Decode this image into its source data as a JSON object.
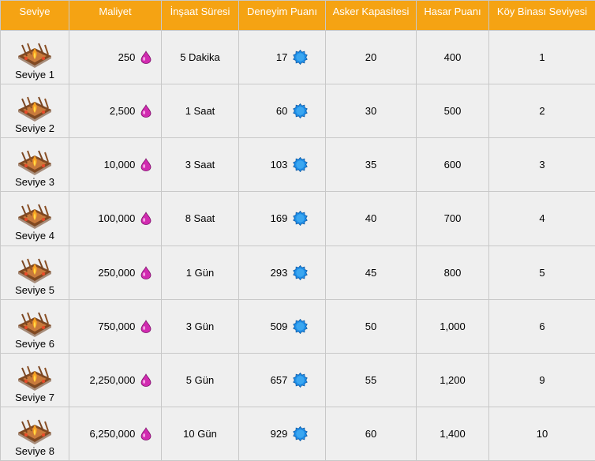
{
  "headers": {
    "level": "Seviye",
    "cost": "Maliyet",
    "build_time": "İnşaat Süresi",
    "xp": "Deneyim Puanı",
    "capacity": "Asker Kapasitesi",
    "hp": "Hasar Puanı",
    "th_level": "Köy Binası Seviyesi"
  },
  "colors": {
    "header_bg": "#f5a313",
    "row_bg": "#efefef",
    "elixir": "#d12bb0",
    "xp_icon": "#1e8ee8"
  },
  "icons": {
    "cost": "elixir-drop-icon",
    "xp": "xp-star-icon"
  },
  "rows": [
    {
      "level": "Seviye 1",
      "cost": "250",
      "time": "5 Dakika",
      "xp": "17",
      "capacity": "20",
      "hp": "400",
      "th": "1"
    },
    {
      "level": "Seviye 2",
      "cost": "2,500",
      "time": "1 Saat",
      "xp": "60",
      "capacity": "30",
      "hp": "500",
      "th": "2"
    },
    {
      "level": "Seviye 3",
      "cost": "10,000",
      "time": "3 Saat",
      "xp": "103",
      "capacity": "35",
      "hp": "600",
      "th": "3"
    },
    {
      "level": "Seviye 4",
      "cost": "100,000",
      "time": "8 Saat",
      "xp": "169",
      "capacity": "40",
      "hp": "700",
      "th": "4"
    },
    {
      "level": "Seviye 5",
      "cost": "250,000",
      "time": "1 Gün",
      "xp": "293",
      "capacity": "45",
      "hp": "800",
      "th": "5"
    },
    {
      "level": "Seviye 6",
      "cost": "750,000",
      "time": "3 Gün",
      "xp": "509",
      "capacity": "50",
      "hp": "1,000",
      "th": "6"
    },
    {
      "level": "Seviye 7",
      "cost": "2,250,000",
      "time": "5 Gün",
      "xp": "657",
      "capacity": "55",
      "hp": "1,200",
      "th": "9"
    },
    {
      "level": "Seviye 8",
      "cost": "6,250,000",
      "time": "10 Gün",
      "xp": "929",
      "capacity": "60",
      "hp": "1,400",
      "th": "10"
    }
  ]
}
